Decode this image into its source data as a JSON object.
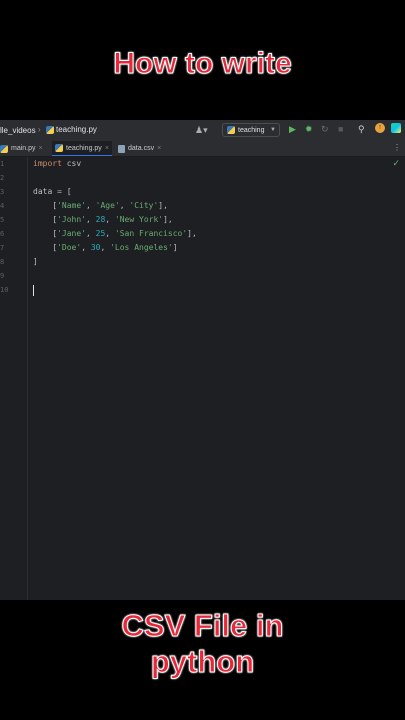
{
  "captions": {
    "top": "How to write",
    "bottom_line1": "CSV File in",
    "bottom_line2": "python"
  },
  "ide": {
    "breadcrumb_project": "lle_videos",
    "breadcrumb_file": "teaching.py",
    "run_config": "teaching",
    "tabs": [
      {
        "label": "main.py",
        "icon": "python-file-icon",
        "active": false
      },
      {
        "label": "teaching.py",
        "icon": "python-file-icon",
        "active": true
      },
      {
        "label": "data.csv",
        "icon": "csv-file-icon",
        "active": false
      }
    ],
    "line_numbers": [
      "1",
      "2",
      "3",
      "4",
      "5",
      "6",
      "7",
      "8",
      "9",
      "10"
    ],
    "code": {
      "l1_kw": "import",
      "l1_rest": " csv",
      "l3": "data = [",
      "rows": [
        {
          "a": "'Name'",
          "b": "'Age'",
          "c": "'City'",
          "b_is_num": false,
          "trail": "],"
        },
        {
          "a": "'John'",
          "b": "28",
          "c": "'New York'",
          "b_is_num": true,
          "trail": "],"
        },
        {
          "a": "'Jane'",
          "b": "25",
          "c": "'San Francisco'",
          "b_is_num": true,
          "trail": "],"
        },
        {
          "a": "'Doe'",
          "b": "30",
          "c": "'Los Angeles'",
          "b_is_num": true,
          "trail": "]"
        }
      ],
      "l8": "]"
    },
    "colors": {
      "keyword": "#cf8e6d",
      "string": "#6aab73",
      "number": "#2aacb8",
      "accent": "#3574f0",
      "run": "#5fb85f"
    }
  }
}
